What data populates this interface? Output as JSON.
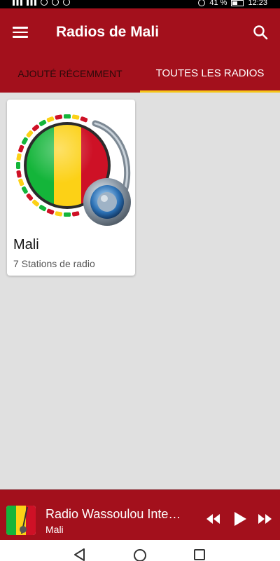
{
  "status_bar": {
    "battery": "41 %",
    "time": "12:23"
  },
  "app_bar": {
    "title": "Radios de Mali",
    "menu_icon": "hamburger-menu-icon",
    "search_icon": "search-icon"
  },
  "tabs": [
    {
      "label": "AJOUTÉ RÉCEMMENT",
      "active": false
    },
    {
      "label": "TOUTES LES RADIOS",
      "active": true
    }
  ],
  "cards": [
    {
      "title": "Mali",
      "subtitle": "7 Stations de radio",
      "image": "mali-flag-headphones-icon"
    }
  ],
  "mini_player": {
    "title": "Radio Wassoulou Inte…",
    "subtitle": "Mali",
    "controls": [
      "rewind-icon",
      "play-icon",
      "fast-forward-icon"
    ]
  },
  "nav_bar": {
    "buttons": [
      "back-icon",
      "home-icon",
      "recents-icon"
    ]
  },
  "colors": {
    "primary": "#a3101c",
    "tab_indicator": "#f5c518",
    "background": "#e0e0e0",
    "flag_green": "#14b53a",
    "flag_yellow": "#fcd116",
    "flag_red": "#ce1126"
  }
}
